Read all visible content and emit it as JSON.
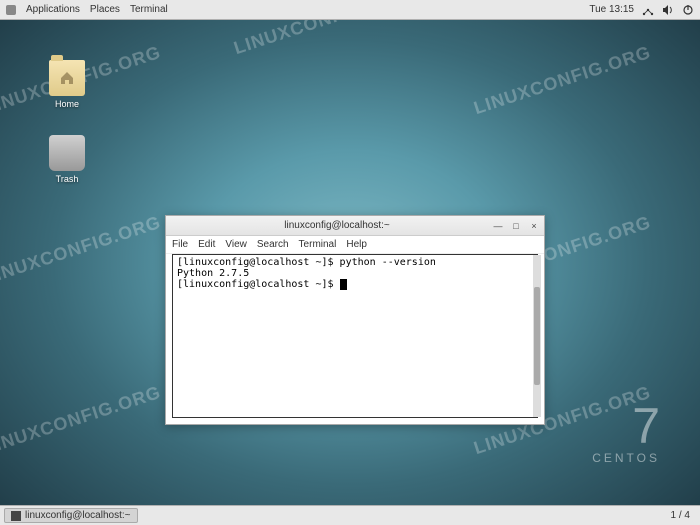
{
  "topbar": {
    "applications": "Applications",
    "places": "Places",
    "terminal": "Terminal",
    "clock": "Tue 13:15"
  },
  "desktop_icons": {
    "home": "Home",
    "trash": "Trash"
  },
  "centos": {
    "version": "7",
    "name": "CENTOS"
  },
  "terminal_window": {
    "title": "linuxconfig@localhost:~",
    "menu": {
      "file": "File",
      "edit": "Edit",
      "view": "View",
      "search": "Search",
      "terminal": "Terminal",
      "help": "Help"
    },
    "lines": {
      "l0": "[linuxconfig@localhost ~]$ python --version",
      "l1": "Python 2.7.5",
      "l2": "[linuxconfig@localhost ~]$ "
    },
    "controls": {
      "min": "—",
      "max": "□",
      "close": "×"
    }
  },
  "bottombar": {
    "task": "linuxconfig@localhost:~",
    "workspaces": "1 / 4"
  },
  "watermark": "LINUXCONFIG.ORG"
}
